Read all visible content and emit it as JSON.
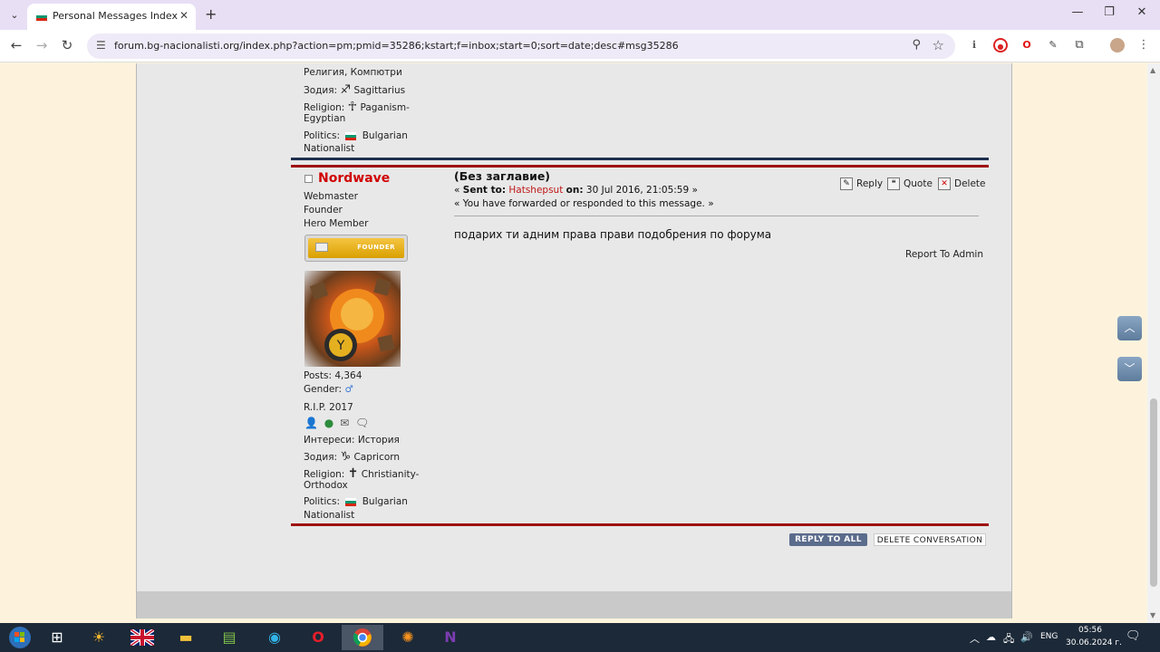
{
  "browser": {
    "tab_title": "Personal Messages Index",
    "tab_close": "✕",
    "new_tab": "+",
    "url": "forum.bg-nacionalisti.org/index.php?action=pm;pmid=35286;kstart;f=inbox;start=0;sort=date;desc#msg35286",
    "window_controls": [
      "—",
      "❐",
      "✕"
    ]
  },
  "prev_post": {
    "interests_partial": "Религия, Компютри",
    "zodiac_label": "Зодия:",
    "zodiac_value": "Sagittarius",
    "religion_label": "Religion:",
    "religion_value_1": "Paganism-",
    "religion_value_2": "Egyptian",
    "politics_label": "Politics:",
    "politics_value_1": "Bulgarian",
    "politics_value_2": "Nationalist"
  },
  "post": {
    "username": "Nordwave",
    "title_1": "Webmaster",
    "title_2": "Founder",
    "title_3": "Hero Member",
    "badge_text": "FOUNDER",
    "posts": "Posts: 4,364",
    "gender_label": "Gender:",
    "gender_icon": "♂",
    "custom_text": "R.I.P. 2017",
    "interests": "Интереси: История",
    "zodiac_label": "Зодия:",
    "zodiac_value": "Capricorn",
    "religion_label": "Religion:",
    "religion_value_1": "Christianity-",
    "religion_value_2": "Orthodox",
    "politics_label": "Politics:",
    "politics_value_1": "Bulgarian",
    "politics_value_2": "Nationalist",
    "subject": "(Без заглавие)",
    "sent_prefix": "« ",
    "sent_label": "Sent to:",
    "recipient": "Hatshepsut",
    "on_label": "on:",
    "date": "30 Jul 2016, 21:05:59 »",
    "forwarded_note": "« You have forwarded or responded to this message. »",
    "body": "подарих ти адним права прави подобрения по форума",
    "report": "Report To Admin",
    "actions": {
      "reply": "Reply",
      "quote": "Quote",
      "delete": "Delete"
    }
  },
  "buttons": {
    "reply_all": "REPLY TO ALL",
    "delete_conversation": "DELETE CONVERSATION"
  },
  "taskbar": {
    "lang": "ENG",
    "time": "05:56",
    "date": "30.06.2024 г."
  }
}
